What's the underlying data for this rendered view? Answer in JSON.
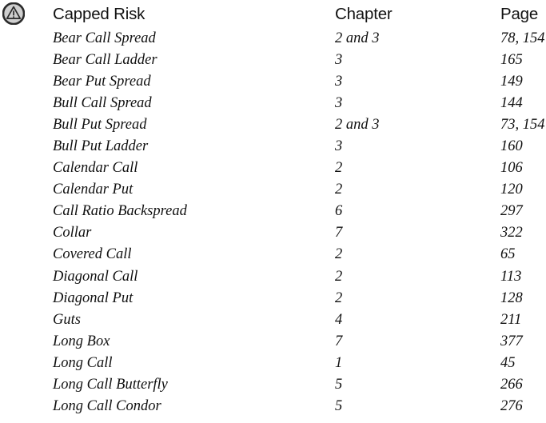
{
  "icon": {
    "name": "warning-triangle-in-circle-icon",
    "ring_color": "#2b2b2b",
    "face_color": "#cfcfcf",
    "glyph_color": "#2b2b2b"
  },
  "table": {
    "headers": {
      "strategy": "Capped Risk",
      "chapter": "Chapter",
      "page": "Page"
    },
    "rows": [
      {
        "strategy": "Bear Call Spread",
        "chapter": "2 and 3",
        "page": "78, 154"
      },
      {
        "strategy": "Bear Call Ladder",
        "chapter": "3",
        "page": "165"
      },
      {
        "strategy": "Bear Put Spread",
        "chapter": "3",
        "page": "149"
      },
      {
        "strategy": "Bull Call Spread",
        "chapter": "3",
        "page": "144"
      },
      {
        "strategy": "Bull Put Spread",
        "chapter": "2 and 3",
        "page": "73, 154"
      },
      {
        "strategy": "Bull Put Ladder",
        "chapter": "3",
        "page": "160"
      },
      {
        "strategy": "Calendar Call",
        "chapter": "2",
        "page": "106"
      },
      {
        "strategy": "Calendar Put",
        "chapter": "2",
        "page": "120"
      },
      {
        "strategy": "Call Ratio Backspread",
        "chapter": "6",
        "page": "297"
      },
      {
        "strategy": "Collar",
        "chapter": "7",
        "page": "322"
      },
      {
        "strategy": "Covered Call",
        "chapter": "2",
        "page": "65"
      },
      {
        "strategy": "Diagonal Call",
        "chapter": "2",
        "page": "113"
      },
      {
        "strategy": "Diagonal Put",
        "chapter": "2",
        "page": "128"
      },
      {
        "strategy": "Guts",
        "chapter": "4",
        "page": "211"
      },
      {
        "strategy": "Long Box",
        "chapter": "7",
        "page": "377"
      },
      {
        "strategy": "Long Call",
        "chapter": "1",
        "page": "45"
      },
      {
        "strategy": "Long Call Butterfly",
        "chapter": "5",
        "page": "266"
      },
      {
        "strategy": "Long Call Condor",
        "chapter": "5",
        "page": "276"
      }
    ]
  }
}
